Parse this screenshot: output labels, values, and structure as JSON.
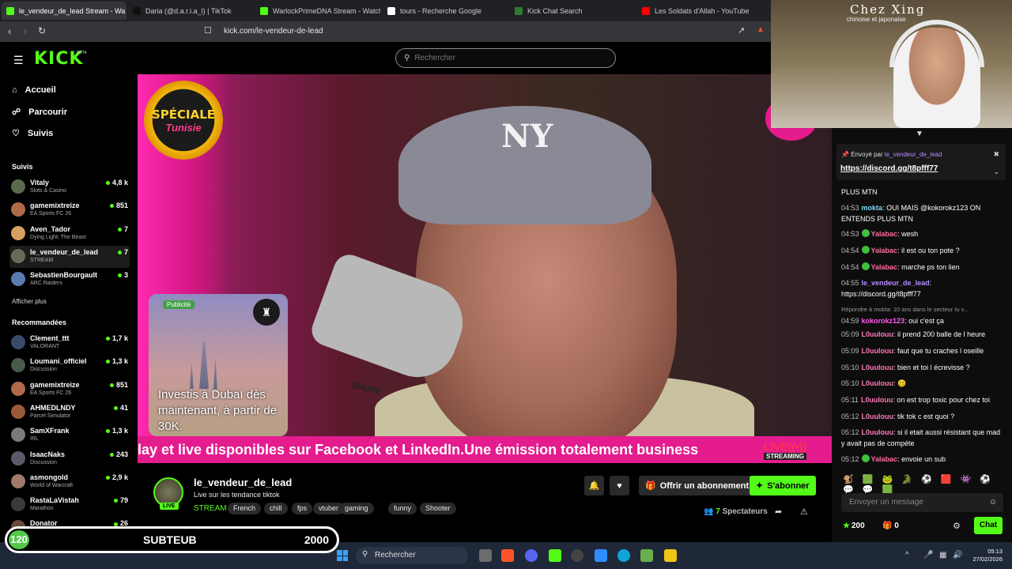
{
  "browser": {
    "tabs": [
      {
        "title": "le_vendeur_de_lead Stream - Wa",
        "color": "#53fc18",
        "active": true
      },
      {
        "title": "Daria (@d.a.r.i.a_l) | TikTok",
        "color": "#111111",
        "active": false
      },
      {
        "title": "WarlockPrimeDNA Stream - Watch L",
        "color": "#53fc18",
        "active": false
      },
      {
        "title": "tours - Recherche Google",
        "color": "#ffffff",
        "active": false
      },
      {
        "title": "Kick Chat Search",
        "color": "#2e7d32",
        "active": false
      },
      {
        "title": "Les Soldats d'Allah - YouTube",
        "color": "#ff0000",
        "active": false
      }
    ],
    "url": "kick.com/le-vendeur-de-lead"
  },
  "header": {
    "logo": "KICK",
    "logo_badge": "BETA",
    "search_placeholder": "Rechercher"
  },
  "sidebar": {
    "nav": [
      {
        "label": "Accueil",
        "icon": "home-icon"
      },
      {
        "label": "Parcourir",
        "icon": "compass-icon"
      },
      {
        "label": "Suivis",
        "icon": "heart-icon"
      }
    ],
    "following_title": "Suivis",
    "following": [
      {
        "name": "Vitaly",
        "game": "Slots & Casino",
        "viewers": "4,8 k",
        "color": "#5a6a4a"
      },
      {
        "name": "gamemixtreize",
        "game": "EA Sports FC 26",
        "viewers": "851",
        "color": "#b06a4a"
      },
      {
        "name": "Aven_Tador",
        "game": "Dying Light: The Beast",
        "viewers": "7",
        "color": "#d8a060"
      },
      {
        "name": "le_vendeur_de_lead",
        "game": "STREAM",
        "viewers": "7",
        "color": "#6a6a5a",
        "selected": true
      },
      {
        "name": "SebastienBourgault",
        "game": "ARC Raiders",
        "viewers": "3",
        "color": "#5a7ab0"
      }
    ],
    "show_more": "Afficher plus",
    "recommended_title": "Recommandées",
    "recommended": [
      {
        "name": "Clement_ttt",
        "game": "VALORANT",
        "viewers": "1,7 k",
        "color": "#3a4a6a"
      },
      {
        "name": "Loumani_officiel",
        "game": "Discussion",
        "viewers": "1,3 k",
        "color": "#4a5a4a"
      },
      {
        "name": "gamemixtreize",
        "game": "EA Sports FC 26",
        "viewers": "851",
        "color": "#b06a4a"
      },
      {
        "name": "AHMEDLNDY",
        "game": "Parcel Simulator",
        "viewers": "41",
        "color": "#9a5a3a"
      },
      {
        "name": "SamXFrank",
        "game": "IRL",
        "viewers": "1,3 k",
        "color": "#7a7a7a"
      },
      {
        "name": "IsaacNaks",
        "game": "Discussion",
        "viewers": "243",
        "color": "#5a5a6a"
      },
      {
        "name": "asmongold",
        "game": "World of Warcraft",
        "viewers": "2,9 k",
        "color": "#a07a6a"
      },
      {
        "name": "RastaLaVistah",
        "game": "Marathon",
        "viewers": "79",
        "color": "#3a3a3a"
      },
      {
        "name": "Donator",
        "game": "Rust",
        "viewers": "26",
        "color": "#6a4a3a"
      }
    ]
  },
  "video": {
    "badge_line1": "SPÉCIALE",
    "badge_line2": "Tunisie",
    "ad_label": "Publicité",
    "ad_text": "Investis à Dubaï dès maintenant, à partir de 30K.",
    "cap_logo": "NY",
    "mic_brand": "SHURE",
    "ticker": "lay et live disponibles sur Facebook et LinkedIn.Une émission totalement business",
    "live_line1": "LIVE((•))",
    "live_line2": "STREAMING"
  },
  "channel": {
    "name": "le_vendeur_de_lead",
    "live": "LIVE",
    "title": "Live sur les tendance tiktok",
    "category": "STREAM",
    "tags": [
      "French",
      "chill",
      "fps",
      "vtuber",
      "gaming",
      "funny",
      "Shooter"
    ],
    "gift_label": "Offrir un abonnement",
    "subscribe_label": "S'abonner",
    "viewers_count": "7",
    "viewers_label": "Spectateurs"
  },
  "webcam": {
    "sign": "Chez Xing",
    "sign_sub": "chinoise et japonaise"
  },
  "chat": {
    "pinned_by": "Envoyé par",
    "pinned_user": "le_vendeur_de_lead",
    "pinned_link": "https://discord.gg/t8pfff77",
    "messages": [
      {
        "time": "",
        "user": "",
        "color": "#fff",
        "text": "PLUS MTN",
        "badge": false
      },
      {
        "time": "04:53",
        "user": "mokta",
        "color": "#7ad8ff",
        "text": "OUI MAIS @kokorokz123 ON ENTENDS PLUS MTN",
        "badge": false
      },
      {
        "time": "04:53",
        "user": "Yalabac",
        "color": "#ff6b9c",
        "text": "wesh",
        "badge": true
      },
      {
        "time": "04:54",
        "user": "Yalabac",
        "color": "#ff6b9c",
        "text": "il est ou ton pote ?",
        "badge": true
      },
      {
        "time": "04:54",
        "user": "Yalabac",
        "color": "#ff6b9c",
        "text": "marche ps ton lien",
        "badge": true
      },
      {
        "time": "04:55",
        "user": "le_vendeur_de_lead",
        "color": "#b48cff",
        "text": "https://discord.gg/t8pfff77",
        "badge": false
      },
      {
        "time": "04:59",
        "user": "kokorokz123",
        "color": "#ff5cf0",
        "text": "oui c'est ça",
        "badge": false,
        "reply": "Répondre à mokta: 10 ans dans le secteur tu v..."
      },
      {
        "time": "05:09",
        "user": "L0uulouu",
        "color": "#ff7ab8",
        "text": "il prend 200 balle de l heure",
        "badge": false
      },
      {
        "time": "05:09",
        "user": "L0uulouu",
        "color": "#ff7ab8",
        "text": "faut que tu craches l oseille",
        "badge": false
      },
      {
        "time": "05:10",
        "user": "L0uulouu",
        "color": "#ff7ab8",
        "text": "bien et toi l écrevisse ?",
        "badge": false
      },
      {
        "time": "05:10",
        "user": "L0uulouu",
        "color": "#ff7ab8",
        "text": "🥴",
        "badge": false
      },
      {
        "time": "05:11",
        "user": "L0uulouu",
        "color": "#ff7ab8",
        "text": "on est trop toxic pour chez toi",
        "badge": false
      },
      {
        "time": "05:12",
        "user": "L0uulouu",
        "color": "#ff7ab8",
        "text": "tik tok c est quoi ?",
        "badge": false
      },
      {
        "time": "05:12",
        "user": "L0uulouu",
        "color": "#ff7ab8",
        "text": "si il etait aussi résistant que mad y avait pas de compéte",
        "badge": false
      },
      {
        "time": "05:12",
        "user": "Yalabac",
        "color": "#ff6b9c",
        "text": "envoie un sub",
        "badge": true
      }
    ],
    "emotes": "🐒 🟩 🐸 🐊 ⚽ 🟥 👾 ⚽ 💬 💬 🟩",
    "input_placeholder": "Envoyer un message",
    "points": "200",
    "gifts": "0",
    "chat_button": "Chat"
  },
  "subgoal": {
    "count": "120",
    "label": "SUBTEUB",
    "goal": "2000"
  },
  "taskbar": {
    "search": "Rechercher",
    "time": "05:13",
    "date": "27/02/2026"
  }
}
